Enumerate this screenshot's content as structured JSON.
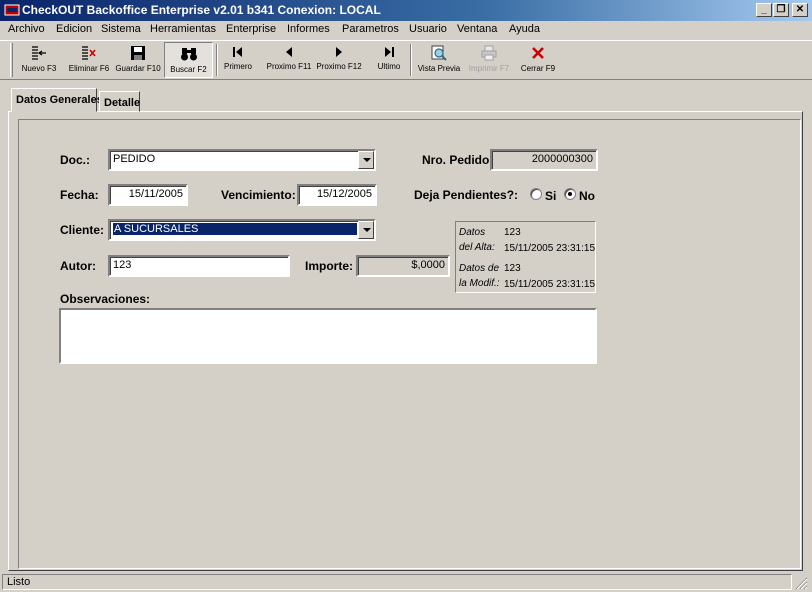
{
  "window": {
    "title": "CheckOUT Backoffice Enterprise v2.01 b341 Conexion: LOCAL",
    "minimize": "_",
    "restore": "❐",
    "close": "✕"
  },
  "menu": [
    "Archivo",
    "Edicion",
    "Sistema",
    "Herramientas",
    "Enterprise",
    "Informes",
    "Parametros",
    "Usuario",
    "Ventana",
    "Ayuda"
  ],
  "toolbar": {
    "nuevo": "Nuevo F3",
    "eliminar": "Eliminar F6",
    "guardar": "Guardar F10",
    "buscar": "Buscar F2",
    "primero": "Primero",
    "proximo11": "Proximo F11",
    "proximo12": "Proximo F12",
    "ultimo": "Ultimo",
    "vista": "Vista Previa",
    "imprimir": "Imprimir F7",
    "cerrar": "Cerrar F9"
  },
  "tabs": {
    "general": "Datos Generales",
    "detalle": "Detalle"
  },
  "form": {
    "doc_label": "Doc.:",
    "doc_value": "PEDIDO",
    "nro_label": "Nro. Pedido:",
    "nro_value": "2000000300",
    "fecha_label": "Fecha:",
    "fecha_value": "15/11/2005",
    "venc_label": "Vencimiento:",
    "venc_value": "15/12/2005",
    "deja_label": "Deja Pendientes?:",
    "si_label": "Si",
    "no_label": "No",
    "cliente_label": "Cliente:",
    "cliente_value": "A SUCURSALES",
    "autor_label": "Autor:",
    "autor_value": "123",
    "importe_label": "Importe:",
    "importe_value": "$,0000",
    "obs_label": "Observaciones:"
  },
  "info": {
    "alta_label1": "Datos",
    "alta_label2": "del Alta:",
    "alta_user": "123",
    "alta_date": "15/11/2005 23:31:15",
    "modif_label1": "Datos de",
    "modif_label2": "la Modif.:",
    "modif_user": "123",
    "modif_date": "15/11/2005 23:31:15"
  },
  "status": "Listo",
  "colors": {
    "titlebar": "#0a246a",
    "face": "#d4d0c8",
    "selection": "#0a246a",
    "close_red": "#cc0000"
  }
}
